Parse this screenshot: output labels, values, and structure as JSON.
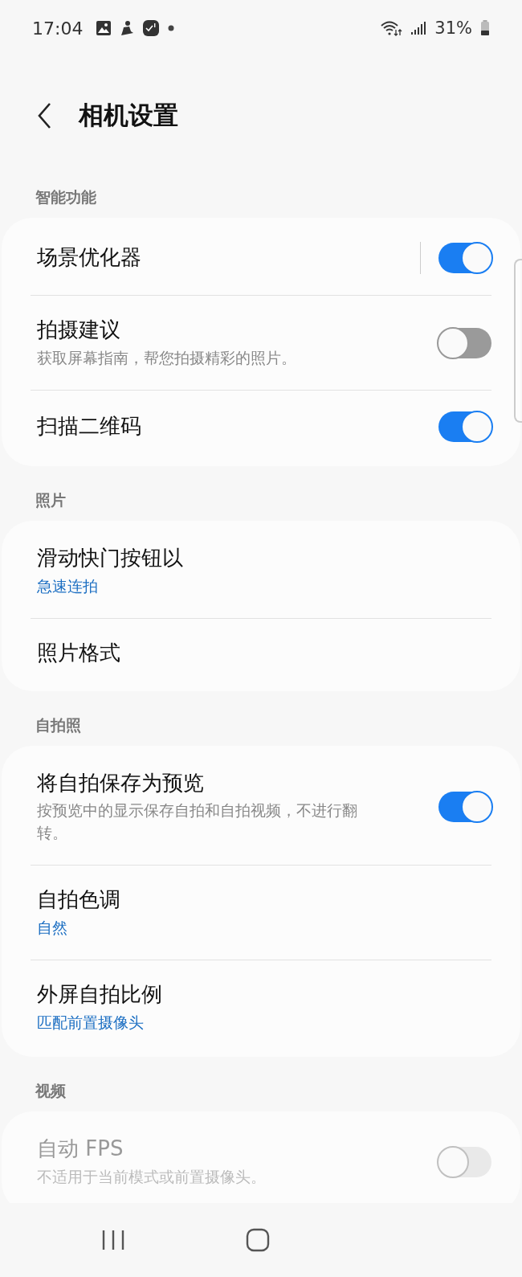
{
  "status_bar": {
    "time": "17:04",
    "battery": "31%"
  },
  "header": {
    "title": "相机设置"
  },
  "sections": [
    {
      "title": "智能功能",
      "items": [
        {
          "kind": "split_switch",
          "title": "场景优化器",
          "on": true,
          "disabled": false
        },
        {
          "kind": "switch",
          "title": "拍摄建议",
          "subtitle": "获取屏幕指南，帮您拍摄精彩的照片。",
          "on": false,
          "disabled": false
        },
        {
          "kind": "switch",
          "title": "扫描二维码",
          "on": true,
          "disabled": false
        }
      ]
    },
    {
      "title": "照片",
      "items": [
        {
          "kind": "link",
          "title": "滑动快门按钮以",
          "value": "急速连拍"
        },
        {
          "kind": "link",
          "title": "照片格式"
        }
      ]
    },
    {
      "title": "自拍照",
      "items": [
        {
          "kind": "switch",
          "title": "将自拍保存为预览",
          "subtitle": "按预览中的显示保存自拍和自拍视频，不进行翻转。",
          "on": true,
          "disabled": false
        },
        {
          "kind": "link",
          "title": "自拍色调",
          "value": "自然"
        },
        {
          "kind": "link",
          "title": "外屏自拍比例",
          "value": "匹配前置摄像头"
        }
      ]
    },
    {
      "title": "视频",
      "items": [
        {
          "kind": "switch",
          "title": "自动 FPS",
          "subtitle": "不适用于当前模式或前置摄像头。",
          "on": false,
          "disabled": true
        }
      ]
    }
  ]
}
